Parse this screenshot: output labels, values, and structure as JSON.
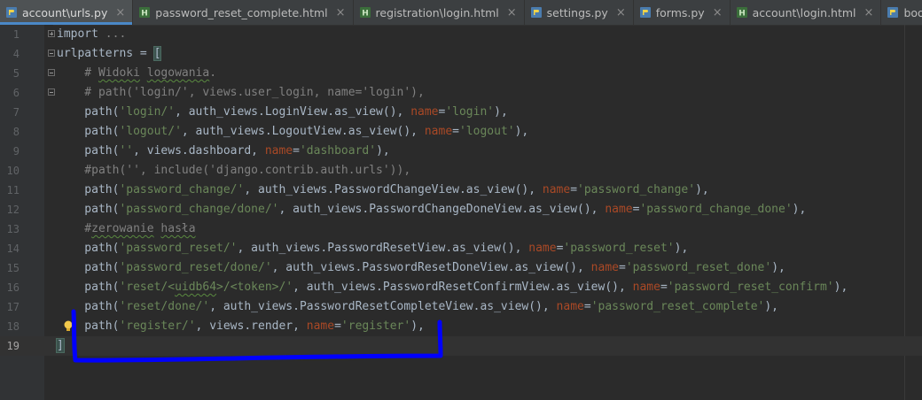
{
  "tabs": [
    {
      "label": "account\\urls.py",
      "kind": "py",
      "active": true
    },
    {
      "label": "password_reset_complete.html",
      "kind": "html",
      "active": false
    },
    {
      "label": "registration\\login.html",
      "kind": "html",
      "active": false
    },
    {
      "label": "settings.py",
      "kind": "py",
      "active": false
    },
    {
      "label": "forms.py",
      "kind": "py",
      "active": false
    },
    {
      "label": "account\\login.html",
      "kind": "html",
      "active": false
    },
    {
      "label": "bookmarks\\urls.py",
      "kind": "py",
      "active": false
    }
  ],
  "editor": {
    "lines": [
      {
        "num": "1",
        "fold": "plus",
        "parts": [
          [
            "c-plain",
            "import "
          ],
          [
            "c-fold",
            "..."
          ]
        ]
      },
      {
        "num": "4",
        "fold": "minus",
        "parts": [
          [
            "c-plain",
            "urlpatterns = "
          ],
          [
            "c-brack",
            "["
          ]
        ]
      },
      {
        "num": "5",
        "fold": "minus",
        "parts": [
          [
            "c-comment",
            "    # "
          ],
          [
            "c-comment wavy",
            "Widoki"
          ],
          [
            "c-comment",
            " "
          ],
          [
            "c-comment wavy",
            "logowania"
          ],
          [
            "c-comment",
            "."
          ]
        ]
      },
      {
        "num": "6",
        "fold": "minus",
        "parts": [
          [
            "c-comment",
            "    # path('login/', views.user_login, name='login'),"
          ]
        ]
      },
      {
        "num": "7",
        "parts": [
          [
            "c-plain",
            "    path("
          ],
          [
            "c-str",
            "'login/'"
          ],
          [
            "c-plain",
            ", auth_views.LoginView.as_view(), "
          ],
          [
            "c-kw",
            "name"
          ],
          [
            "c-plain",
            "="
          ],
          [
            "c-str",
            "'login'"
          ],
          [
            "c-plain",
            "),"
          ]
        ]
      },
      {
        "num": "8",
        "parts": [
          [
            "c-plain",
            "    path("
          ],
          [
            "c-str",
            "'logout/'"
          ],
          [
            "c-plain",
            ", auth_views.LogoutView.as_view(), "
          ],
          [
            "c-kw",
            "name"
          ],
          [
            "c-plain",
            "="
          ],
          [
            "c-str",
            "'logout'"
          ],
          [
            "c-plain",
            "),"
          ]
        ]
      },
      {
        "num": "9",
        "parts": [
          [
            "c-plain",
            "    path("
          ],
          [
            "c-str",
            "''"
          ],
          [
            "c-plain",
            ", views.dashboard, "
          ],
          [
            "c-kw",
            "name"
          ],
          [
            "c-plain",
            "="
          ],
          [
            "c-str",
            "'dashboard'"
          ],
          [
            "c-plain",
            "),"
          ]
        ]
      },
      {
        "num": "10",
        "parts": [
          [
            "c-comment",
            "    #path('', include('django.contrib.auth.urls')),"
          ]
        ]
      },
      {
        "num": "11",
        "parts": [
          [
            "c-plain",
            "    path("
          ],
          [
            "c-str",
            "'password_change/'"
          ],
          [
            "c-plain",
            ", auth_views.PasswordChangeView.as_view(), "
          ],
          [
            "c-kw",
            "name"
          ],
          [
            "c-plain",
            "="
          ],
          [
            "c-str",
            "'password_change'"
          ],
          [
            "c-plain",
            "),"
          ]
        ]
      },
      {
        "num": "12",
        "parts": [
          [
            "c-plain",
            "    path("
          ],
          [
            "c-str",
            "'password_change/done/'"
          ],
          [
            "c-plain",
            ", auth_views.PasswordChangeDoneView.as_view(), "
          ],
          [
            "c-kw",
            "name"
          ],
          [
            "c-plain",
            "="
          ],
          [
            "c-str",
            "'password_change_done'"
          ],
          [
            "c-plain",
            "),"
          ]
        ]
      },
      {
        "num": "13",
        "parts": [
          [
            "c-comment",
            "    #"
          ],
          [
            "c-comment wavy",
            "zerowanie"
          ],
          [
            "c-comment",
            " "
          ],
          [
            "c-comment wavy",
            "hasła"
          ]
        ]
      },
      {
        "num": "14",
        "parts": [
          [
            "c-plain",
            "    path("
          ],
          [
            "c-str",
            "'password_reset/'"
          ],
          [
            "c-plain",
            ", auth_views.PasswordResetView.as_view(), "
          ],
          [
            "c-kw",
            "name"
          ],
          [
            "c-plain",
            "="
          ],
          [
            "c-str",
            "'password_reset'"
          ],
          [
            "c-plain",
            "),"
          ]
        ]
      },
      {
        "num": "15",
        "parts": [
          [
            "c-plain",
            "    path("
          ],
          [
            "c-str",
            "'password_reset/done/'"
          ],
          [
            "c-plain",
            ", auth_views.PasswordResetDoneView.as_view(), "
          ],
          [
            "c-kw",
            "name"
          ],
          [
            "c-plain",
            "="
          ],
          [
            "c-str",
            "'password_reset_done'"
          ],
          [
            "c-plain",
            "),"
          ]
        ]
      },
      {
        "num": "16",
        "parts": [
          [
            "c-plain",
            "    path("
          ],
          [
            "c-str",
            "'reset/<"
          ],
          [
            "c-str wavy",
            "uidb64"
          ],
          [
            "c-str",
            ">/<token>/'"
          ],
          [
            "c-plain",
            ", auth_views.PasswordResetConfirmView.as_view(), "
          ],
          [
            "c-kw",
            "name"
          ],
          [
            "c-plain",
            "="
          ],
          [
            "c-str",
            "'password_reset_confirm'"
          ],
          [
            "c-plain",
            "),"
          ]
        ]
      },
      {
        "num": "17",
        "parts": [
          [
            "c-plain",
            "    path("
          ],
          [
            "c-str",
            "'reset/done/'"
          ],
          [
            "c-plain",
            ", auth_views.PasswordResetCompleteView.as_view(), "
          ],
          [
            "c-kw",
            "name"
          ],
          [
            "c-plain",
            "="
          ],
          [
            "c-str",
            "'password_reset_complete'"
          ],
          [
            "c-plain",
            "),"
          ]
        ]
      },
      {
        "num": "18",
        "bulb": true,
        "parts": [
          [
            "c-plain",
            "    path("
          ],
          [
            "c-str",
            "'register/'"
          ],
          [
            "c-plain",
            ", views.render, "
          ],
          [
            "c-kw",
            "name"
          ],
          [
            "c-plain",
            "="
          ],
          [
            "c-str",
            "'register'"
          ],
          [
            "c-plain",
            "),"
          ]
        ]
      },
      {
        "num": "19",
        "current": true,
        "caret": true,
        "parts": [
          [
            "c-brack",
            "]"
          ]
        ]
      }
    ]
  },
  "colors": {
    "background": "#2b2b2b",
    "gutter": "#313335",
    "tabbar": "#3c3f41",
    "string": "#6a8759",
    "keyword_arg": "#aa4926",
    "comment": "#808080",
    "text": "#a9b7c6",
    "annotation": "#0000ff"
  },
  "icons": {
    "py": "python-file-icon",
    "html": "html-file-icon",
    "close": "close-icon",
    "bulb": "intention-bulb-icon"
  }
}
